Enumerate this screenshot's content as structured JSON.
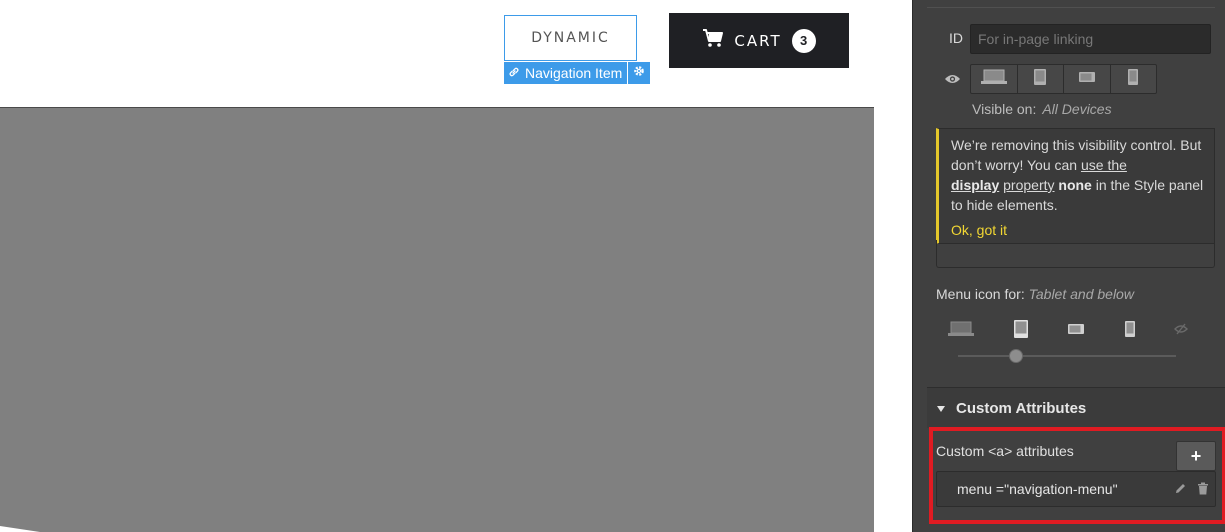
{
  "canvas": {
    "nav_item": {
      "label": "DYNAMIC"
    },
    "selection_tag": {
      "label": "Navigation Item"
    },
    "cart": {
      "label": "CART",
      "count": "3"
    }
  },
  "panel": {
    "id_field": {
      "label": "ID",
      "placeholder": "For in-page linking"
    },
    "visibility": {
      "label": "Visible on:",
      "value": "All Devices",
      "devices": [
        "desktop",
        "tablet",
        "mobile-landscape",
        "mobile-portrait"
      ]
    },
    "notice": {
      "line1": "We’re removing this visibility control. But don’t worry! You can",
      "link1": "use the",
      "bold1": "display",
      "link2": "property",
      "bold2": "none",
      "line2": "in the Style panel to hide elements.",
      "action": "Ok, got it",
      "accent_color": "#e5c82b"
    },
    "menu_icon": {
      "label": "Menu icon for:",
      "value": "Tablet and below",
      "slider_position": 0.25
    },
    "custom_attributes": {
      "section_title": "Custom Attributes",
      "label": "Custom <a> attributes",
      "add_label": "+",
      "attribute_name": "menu",
      "attribute_value": "navigation-menu",
      "highlight_color": "#e01b22"
    }
  }
}
